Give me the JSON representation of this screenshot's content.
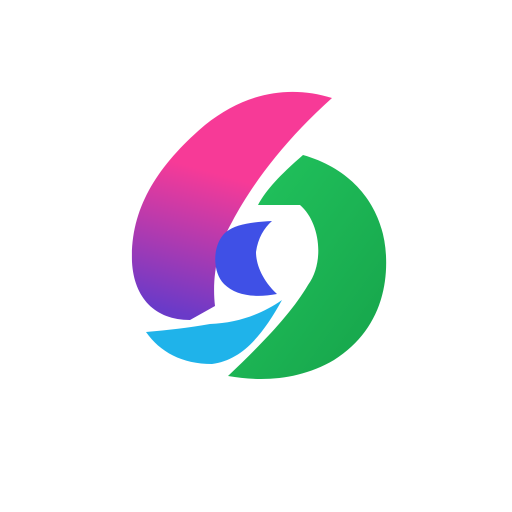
{
  "logo": {
    "icon": "swirl-six-nine-logo-icon",
    "colors": {
      "background": "#ffffff",
      "pink": "#f73a97",
      "purple": "#6a3ac8",
      "blue": "#3f50e6",
      "cyan": "#1fb3ea",
      "green_light": "#22c55e",
      "green_dark": "#16a34a"
    }
  }
}
